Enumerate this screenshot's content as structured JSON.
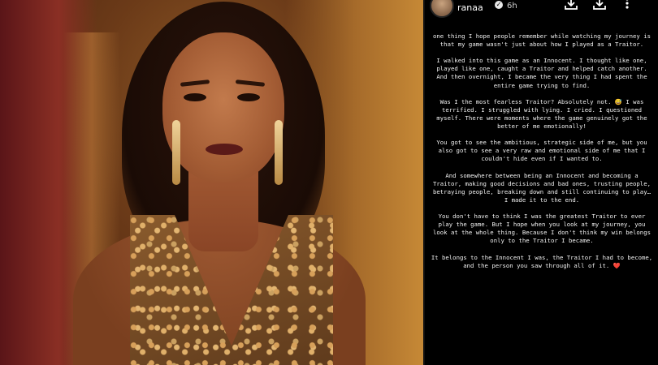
{
  "story": {
    "username": "ranaa",
    "verified_glyph": "✓",
    "time": "6h",
    "paragraphs": [
      "one thing I hope people remember while watching my journey is that my game wasn't just about how I played as a Traitor.",
      "I walked into this game as an Innocent. I thought like one, played like one, caught a Traitor and helped catch another. And then overnight, I became the very thing I had spent the entire game trying to find.",
      "Was I the most fearless Traitor? Absolutely not. 😅 I was terrified. I struggled with lying. I cried. I questioned myself. There were moments where the game genuinely got the better of me emotionally!",
      "You got to see the ambitious, strategic side of me, but you also got to see a very raw and emotional side of me that I couldn't hide even if I wanted to.",
      "And somewhere between being an Innocent and becoming a Traitor, making good decisions and bad ones, trusting people, betraying people, breaking down and still continuing to play… I made it to the end.",
      "You don't have to think I was the greatest Traitor to ever play the game. But I hope when you look at my journey, you look at the whole thing. Because I don't think my win belongs only to the Traitor I became.",
      "It belongs to the Innocent I was, the Traitor I had to become, and the person you saw through all of it. ❤️"
    ]
  },
  "icons": {
    "download_1": "download-icon",
    "download_2": "download-icon",
    "more": "more-vertical-icon"
  }
}
